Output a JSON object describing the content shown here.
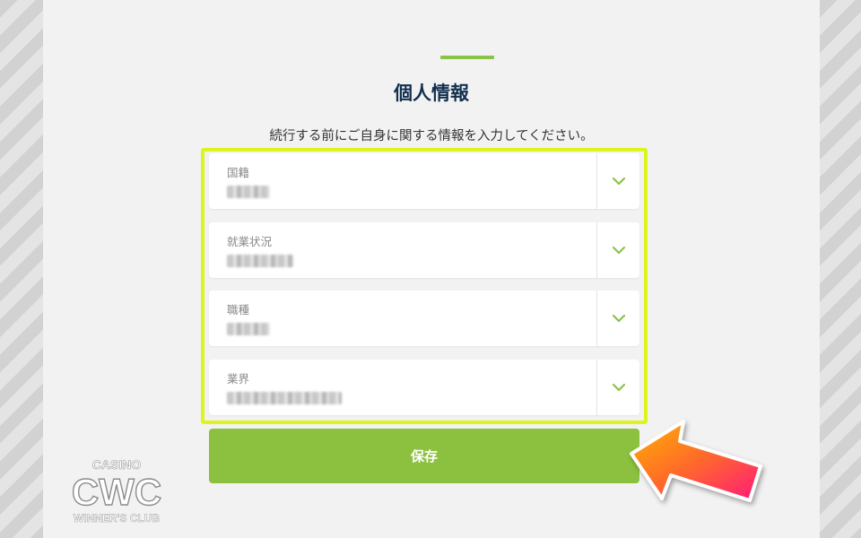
{
  "header": {
    "title": "個人情報",
    "subtitle": "続行する前にご自身に関する情報を入力してください。"
  },
  "form": {
    "fields": [
      {
        "label": "国籍"
      },
      {
        "label": "就業状況"
      },
      {
        "label": "職種"
      },
      {
        "label": "業界"
      }
    ],
    "save_label": "保存"
  },
  "logo": {
    "top": "CASINO",
    "main": "CWC",
    "bottom": "WINNER'S CLUB"
  },
  "colors": {
    "accent": "#8bc34a",
    "button": "#8bc13f",
    "highlight": "#ddf51a",
    "title": "#12304f"
  },
  "icons": {
    "dropdown": "chevron-down-icon",
    "annotation": "arrow-icon"
  }
}
